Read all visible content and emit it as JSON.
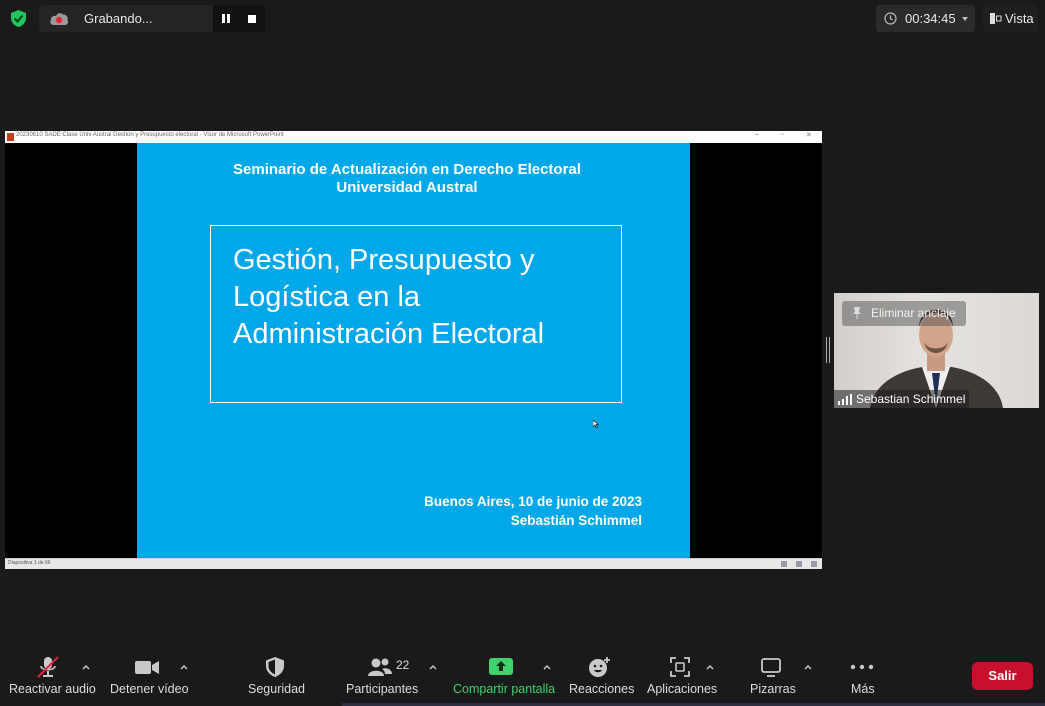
{
  "topbar": {
    "recording_label": "Grabando...",
    "timer": "00:34:45",
    "view_label": "Vista"
  },
  "shared_window": {
    "title": "20230610 SADE Clase Univ Austral Gestion y Presupuesto electoral - Visor de Microsoft PowerPoint",
    "status": "Diapositiva 1 de 66"
  },
  "slide": {
    "heading_line1": "Seminario de Actualización en Derecho Electoral",
    "heading_line2": "Universidad Austral",
    "title_line1": "Gestión, Presupuesto y",
    "title_line2": "Logística en la",
    "title_line3": "Administración Electoral",
    "footer_line1": "Buenos Aires, 10 de junio de 2023",
    "footer_line2": "Sebastián Schimmel",
    "background_color": "#00a7e9"
  },
  "video_tile": {
    "unpin_label": "Eliminar anclaje",
    "participant_name": "Sebastian Schimmel"
  },
  "toolbar": {
    "audio_label": "Reactivar audio",
    "video_label": "Detener vídeo",
    "security_label": "Seguridad",
    "participants_label": "Participantes",
    "participants_count": "22",
    "share_label": "Compartir pantalla",
    "reactions_label": "Reacciones",
    "apps_label": "Aplicaciones",
    "whiteboards_label": "Pizarras",
    "more_label": "Más",
    "leave_label": "Salir",
    "share_color": "#3ed16c",
    "leave_color": "#c8102e"
  }
}
